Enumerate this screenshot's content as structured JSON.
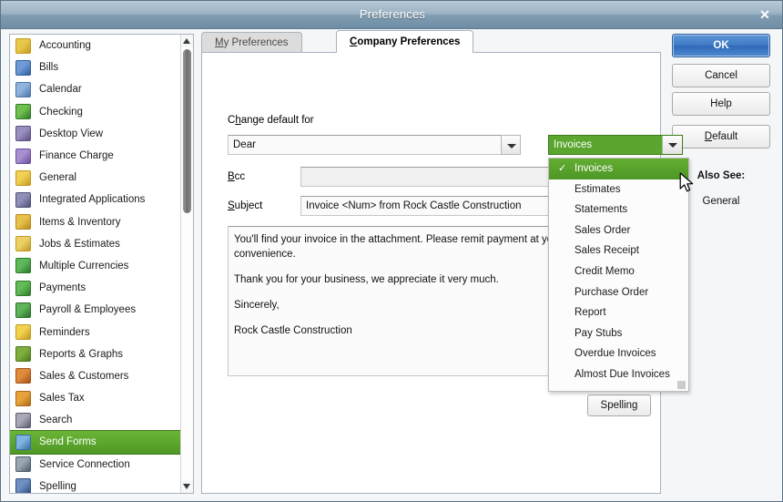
{
  "window": {
    "title": "Preferences",
    "close_label": "✕"
  },
  "sidebar": {
    "items": [
      {
        "label": "Accounting",
        "icon": "accounting-icon",
        "c1": "#e8c84a",
        "c2": "#c79a22",
        "selected": false
      },
      {
        "label": "Bills",
        "icon": "bills-icon",
        "c1": "#6f9ad6",
        "c2": "#2f5e9e",
        "selected": false
      },
      {
        "label": "Calendar",
        "icon": "calendar-icon",
        "c1": "#8fb4dd",
        "c2": "#4c73a8",
        "selected": false
      },
      {
        "label": "Checking",
        "icon": "checking-icon",
        "c1": "#6fc04f",
        "c2": "#2f7a27",
        "selected": false
      },
      {
        "label": "Desktop View",
        "icon": "desktop-view-icon",
        "c1": "#9b8fc0",
        "c2": "#5d5184",
        "selected": false
      },
      {
        "label": "Finance Charge",
        "icon": "finance-charge-icon",
        "c1": "#a78fd0",
        "c2": "#6a4f9e",
        "selected": false
      },
      {
        "label": "General",
        "icon": "general-icon",
        "c1": "#f0cf55",
        "c2": "#c59a1f",
        "selected": false
      },
      {
        "label": "Integrated Applications",
        "icon": "integrated-applications-icon",
        "c1": "#8f8fb8",
        "c2": "#4e4e78",
        "selected": false
      },
      {
        "label": "Items & Inventory",
        "icon": "items-inventory-icon",
        "c1": "#e8c14a",
        "c2": "#b88a1c",
        "selected": false
      },
      {
        "label": "Jobs & Estimates",
        "icon": "jobs-estimates-icon",
        "c1": "#ecd066",
        "c2": "#c09a25",
        "selected": false
      },
      {
        "label": "Multiple Currencies",
        "icon": "multiple-currencies-icon",
        "c1": "#5fb85a",
        "c2": "#2d7a2b",
        "selected": false
      },
      {
        "label": "Payments",
        "icon": "payments-icon",
        "c1": "#63bb57",
        "c2": "#2d7b2a",
        "selected": false
      },
      {
        "label": "Payroll & Employees",
        "icon": "payroll-employees-icon",
        "c1": "#5fb35a",
        "c2": "#2a7029",
        "selected": false
      },
      {
        "label": "Reminders",
        "icon": "reminders-icon",
        "c1": "#f2d24f",
        "c2": "#c09a1c",
        "selected": false
      },
      {
        "label": "Reports & Graphs",
        "icon": "reports-graphs-icon",
        "c1": "#7fae3f",
        "c2": "#4d7a1c",
        "selected": false
      },
      {
        "label": "Sales & Customers",
        "icon": "sales-customers-icon",
        "c1": "#e08a3c",
        "c2": "#a4521a",
        "selected": false
      },
      {
        "label": "Sales Tax",
        "icon": "sales-tax-icon",
        "c1": "#e8a33c",
        "c2": "#a86a16",
        "selected": false
      },
      {
        "label": "Search",
        "icon": "search-icon",
        "c1": "#a8a8b8",
        "c2": "#5b5b70",
        "selected": false
      },
      {
        "label": "Send Forms",
        "icon": "send-forms-icon",
        "c1": "#7fb3e0",
        "c2": "#3a6fa8",
        "selected": true
      },
      {
        "label": "Service Connection",
        "icon": "service-connection-icon",
        "c1": "#9aa6b4",
        "c2": "#4e5c6c",
        "selected": false
      },
      {
        "label": "Spelling",
        "icon": "spelling-icon",
        "c1": "#6f8fc0",
        "c2": "#2f4e84",
        "selected": false
      }
    ],
    "scroll_up": "▲",
    "scroll_down": "▼"
  },
  "tabs": [
    {
      "id": "my",
      "label": "My Preferences",
      "accel": "M",
      "active": false
    },
    {
      "id": "company",
      "label": "Company Preferences",
      "accel": "C",
      "active": true
    }
  ],
  "form": {
    "change_default_label": "Change default for",
    "change_default_accel": "h",
    "salutation_value": "Dear",
    "bcc_label": "Bcc",
    "bcc_accel": "B",
    "bcc_value": "",
    "subject_label": "Subject",
    "subject_accel": "S",
    "subject_value": "Invoice <Num> from Rock Castle Construction",
    "body_paragraphs": [
      "You'll find your invoice in the attachment. Please remit payment at your earliest convenience.",
      "Thank you for your business, we appreciate it very much.",
      "Sincerely,",
      "Rock Castle Construction"
    ],
    "spelling_label": "Spelling"
  },
  "combo": {
    "value": "Invoices",
    "arrow": "▼",
    "options": [
      {
        "label": "Invoices",
        "checked": true
      },
      {
        "label": "Estimates",
        "checked": false
      },
      {
        "label": "Statements",
        "checked": false
      },
      {
        "label": "Sales Order",
        "checked": false
      },
      {
        "label": "Sales Receipt",
        "checked": false
      },
      {
        "label": "Credit Memo",
        "checked": false
      },
      {
        "label": "Purchase Order",
        "checked": false
      },
      {
        "label": "Report",
        "checked": false
      },
      {
        "label": "Pay Stubs",
        "checked": false
      },
      {
        "label": "Overdue Invoices",
        "checked": false
      },
      {
        "label": "Almost Due Invoices",
        "checked": false
      }
    ],
    "check_glyph": "✓"
  },
  "buttons": {
    "ok": "OK",
    "cancel": "Cancel",
    "help": "Help",
    "default": "Default",
    "default_accel": "D",
    "also_see": "Also See:",
    "also_see_link": "General"
  },
  "colors": {
    "accent_green": "#5aa62e",
    "ok_blue": "#3f79c4",
    "titlebar": "#7f9bb0"
  }
}
